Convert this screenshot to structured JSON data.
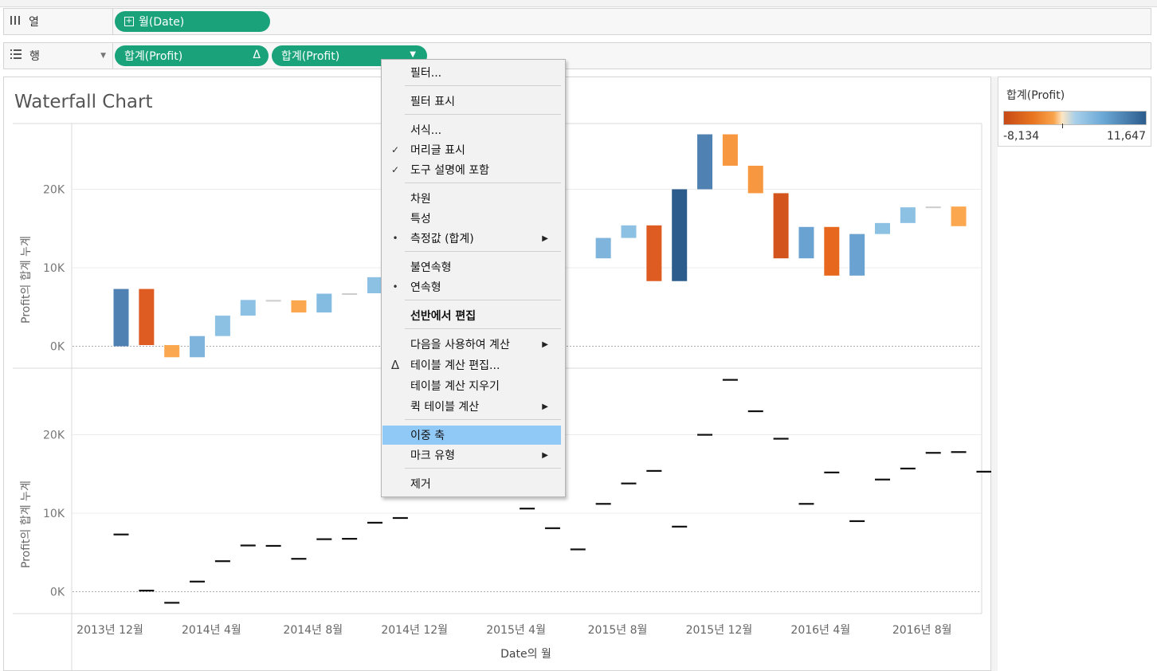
{
  "shelves": {
    "columns": {
      "label": "열",
      "icon": "bars-icon",
      "pills": [
        {
          "label": "월(Date)",
          "icon": "plus-box-icon"
        }
      ]
    },
    "rows": {
      "label": "행",
      "icon": "list-icon",
      "pills": [
        {
          "label": "합계(Profit)",
          "badge": "Δ"
        },
        {
          "label": "합계(Profit)",
          "badge": "▼"
        }
      ]
    }
  },
  "viz": {
    "title": "Waterfall Chart",
    "y_axis_label": "Profit의 합계 누계",
    "x_axis_label": "Date의 월",
    "y_ticks": [
      "0K",
      "10K",
      "20K"
    ],
    "x_ticks": [
      "2013년 12월",
      "2014년 4월",
      "2014년 8월",
      "2014년 12월",
      "2015년 4월",
      "2015년 8월",
      "2015년 12월",
      "2016년 4월",
      "2016년 8월"
    ]
  },
  "legend": {
    "title": "합계(Profit)",
    "min": "-8,134",
    "max": "11,647"
  },
  "context_menu": {
    "items": [
      {
        "label": "필터...",
        "mark": "",
        "submenu": false
      },
      {
        "label": "필터 표시",
        "mark": "",
        "submenu": false
      },
      {
        "label": "서식...",
        "mark": "",
        "submenu": false
      },
      {
        "label": "머리글 표시",
        "mark": "✓",
        "submenu": false
      },
      {
        "label": "도구 설명에 포함",
        "mark": "✓",
        "submenu": false
      },
      {
        "label": "차원",
        "mark": "",
        "submenu": false
      },
      {
        "label": "특성",
        "mark": "",
        "submenu": false
      },
      {
        "label": "측정값 (합계)",
        "mark": "•",
        "submenu": true
      },
      {
        "label": "불연속형",
        "mark": "",
        "submenu": false
      },
      {
        "label": "연속형",
        "mark": "•",
        "submenu": false
      },
      {
        "label": "선반에서 편집",
        "mark": "",
        "submenu": false
      },
      {
        "label": "다음을 사용하여 계산",
        "mark": "",
        "submenu": true
      },
      {
        "label": "테이블 계산 편집...",
        "mark": "Δ",
        "submenu": false
      },
      {
        "label": "테이블 계산 지우기",
        "mark": "",
        "submenu": false
      },
      {
        "label": "퀵 테이블 계산",
        "mark": "",
        "submenu": true
      },
      {
        "label": "이중 축",
        "mark": "",
        "submenu": false,
        "highlighted": true
      },
      {
        "label": "마크 유형",
        "mark": "",
        "submenu": true
      },
      {
        "label": "제거",
        "mark": "",
        "submenu": false
      }
    ]
  },
  "chart_data": {
    "type": "bar",
    "months": 37,
    "series_top": {
      "name": "합계(Profit)",
      "ylim": [
        -2000,
        28000
      ],
      "bars": [
        {
          "m": 0,
          "start": 0,
          "end": 7300,
          "color": "#4f81b3"
        },
        {
          "m": 1,
          "start": 7300,
          "end": 150,
          "color": "#de5b22"
        },
        {
          "m": 2,
          "start": 150,
          "end": -1400,
          "color": "#fba74f"
        },
        {
          "m": 3,
          "start": -1400,
          "end": 1300,
          "color": "#7fb4dc"
        },
        {
          "m": 4,
          "start": 1300,
          "end": 3900,
          "color": "#8cc1e4"
        },
        {
          "m": 5,
          "start": 3900,
          "end": 5900,
          "color": "#8cc1e4"
        },
        {
          "m": 6,
          "start": 5900,
          "end": 5850,
          "color": "#cccccc"
        },
        {
          "m": 7,
          "start": 5850,
          "end": 4300,
          "color": "#fba74f"
        },
        {
          "m": 8,
          "start": 4300,
          "end": 6700,
          "color": "#84bbe1"
        },
        {
          "m": 9,
          "start": 6700,
          "end": 6750,
          "color": "#cccccc"
        },
        {
          "m": 10,
          "start": 6750,
          "end": 8800,
          "color": "#8cc1e4"
        },
        {
          "m": 19,
          "start": 11200,
          "end": 13800,
          "color": "#7fb4dc"
        },
        {
          "m": 20,
          "start": 13800,
          "end": 15400,
          "color": "#8cc1e4"
        },
        {
          "m": 21,
          "start": 15400,
          "end": 8300,
          "color": "#de5b22"
        },
        {
          "m": 22,
          "start": 8300,
          "end": 20000,
          "color": "#2c5c8c"
        },
        {
          "m": 23,
          "start": 20000,
          "end": 27000,
          "color": "#4f81b3"
        },
        {
          "m": 24,
          "start": 27000,
          "end": 23000,
          "color": "#f7973f"
        },
        {
          "m": 25,
          "start": 23000,
          "end": 19500,
          "color": "#f7973f"
        },
        {
          "m": 26,
          "start": 19500,
          "end": 11200,
          "color": "#d4541d"
        },
        {
          "m": 27,
          "start": 11200,
          "end": 15200,
          "color": "#6aa2d1"
        },
        {
          "m": 28,
          "start": 15200,
          "end": 9000,
          "color": "#e8671f"
        },
        {
          "m": 29,
          "start": 9000,
          "end": 14300,
          "color": "#6aa2d1"
        },
        {
          "m": 30,
          "start": 14300,
          "end": 15700,
          "color": "#8cc1e4"
        },
        {
          "m": 31,
          "start": 15700,
          "end": 17700,
          "color": "#8cc1e4"
        },
        {
          "m": 32,
          "start": 17700,
          "end": 17800,
          "color": "#cccccc"
        },
        {
          "m": 33,
          "start": 17800,
          "end": 15300,
          "color": "#fba74f"
        }
      ]
    },
    "series_bottom": {
      "name": "합계(Profit)",
      "ylim": [
        -2000,
        28000
      ],
      "points": [
        {
          "m": 0,
          "y": 7300
        },
        {
          "m": 1,
          "y": 150
        },
        {
          "m": 2,
          "y": -1400
        },
        {
          "m": 3,
          "y": 1300
        },
        {
          "m": 4,
          "y": 3900
        },
        {
          "m": 5,
          "y": 5900
        },
        {
          "m": 6,
          "y": 5850
        },
        {
          "m": 7,
          "y": 4200
        },
        {
          "m": 8,
          "y": 6700
        },
        {
          "m": 9,
          "y": 6750
        },
        {
          "m": 10,
          "y": 8800
        },
        {
          "m": 11,
          "y": 9400
        },
        {
          "m": 15,
          "y": 12200
        },
        {
          "m": 16,
          "y": 10600
        },
        {
          "m": 17,
          "y": 8100
        },
        {
          "m": 18,
          "y": 5400
        },
        {
          "m": 19,
          "y": 11200
        },
        {
          "m": 20,
          "y": 13800
        },
        {
          "m": 21,
          "y": 15400
        },
        {
          "m": 22,
          "y": 8300
        },
        {
          "m": 23,
          "y": 20000
        },
        {
          "m": 24,
          "y": 27000
        },
        {
          "m": 25,
          "y": 23000
        },
        {
          "m": 26,
          "y": 19500
        },
        {
          "m": 27,
          "y": 11200
        },
        {
          "m": 28,
          "y": 15200
        },
        {
          "m": 29,
          "y": 9000
        },
        {
          "m": 30,
          "y": 14300
        },
        {
          "m": 31,
          "y": 15700
        },
        {
          "m": 32,
          "y": 17700
        },
        {
          "m": 33,
          "y": 17800
        },
        {
          "m": 34,
          "y": 15300
        }
      ]
    },
    "x_tick_months": [
      0,
      4,
      8,
      12,
      16,
      20,
      24,
      28,
      32
    ],
    "grid": true
  }
}
